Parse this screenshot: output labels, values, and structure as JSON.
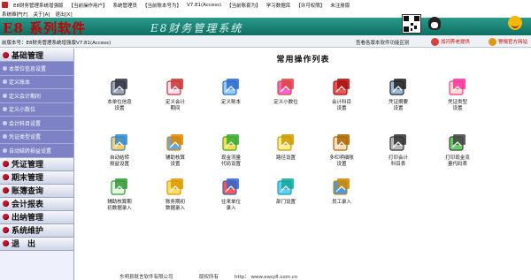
{
  "window": {
    "title": "E8财务管理系统增强版",
    "title_tabs": [
      "【当前操作用户】",
      "系统管理员",
      "【当前账本号为】",
      "V7.81(Access)",
      "【当前账套为】",
      "学习数据库",
      "【许可权限】",
      "未注册版"
    ]
  },
  "menu": [
    "系统维护[F]",
    "关于[A]",
    "退出[X]"
  ],
  "header": {
    "brand": "E8 系列软件",
    "banner": "E8财务管理系统"
  },
  "infobar": {
    "version": "前版本号：E8财务管理系统增强版V7.81(Access)",
    "compare": "查看各版本软件功能区别",
    "links": [
      "加河养老提供",
      "警惕官方网站"
    ]
  },
  "sidebar": {
    "groups": [
      {
        "label": "基础管理",
        "items": [
          "本单位信息设置",
          "定义账本",
          "定义会计期间",
          "定义小数位",
          "会计科目设置",
          "凭证类型设置",
          "自动结转损益设置"
        ]
      },
      {
        "label": "凭证管理"
      },
      {
        "label": "期末管理"
      },
      {
        "label": "账簿查询"
      },
      {
        "label": "会计报表"
      },
      {
        "label": "出纳管理"
      },
      {
        "label": "系统维护"
      },
      {
        "label": "退　出"
      }
    ]
  },
  "main": {
    "title": "常用操作列表",
    "tiles": [
      {
        "label": "本单位信息\n设置",
        "icon": "monitor-icon"
      },
      {
        "label": "定义会计\n期间",
        "icon": "calendar-icon"
      },
      {
        "label": "定义账本",
        "icon": "tools-icon"
      },
      {
        "label": "定义小数位",
        "icon": "books-icon"
      },
      {
        "label": "会计科目\n设置",
        "icon": "ledger-stack-icon"
      },
      {
        "label": "凭证摘要\n设置",
        "icon": "notebook-icon"
      },
      {
        "label": "凭证类型\n设置",
        "icon": "pen-book-icon"
      },
      {
        "label": "自动结转\n损益设置",
        "icon": "chart-book-icon"
      },
      {
        "label": "辅助核算\n设置",
        "icon": "pencil-ruler-icon"
      },
      {
        "label": "现金流量\n代码设置",
        "icon": "cash-flow-icon"
      },
      {
        "label": "路径设置",
        "icon": "hexagon-icon"
      },
      {
        "label": "多栏明细账\n设置",
        "icon": "writing-icon"
      },
      {
        "label": "打印会计\n科目表",
        "icon": "printer-icon"
      },
      {
        "label": "打印现金流\n量代码表",
        "icon": "print-list-icon"
      },
      {
        "label": "辅助核算期\n初数据录入",
        "icon": "checklist-icon"
      },
      {
        "label": "账务期初\n数据录入",
        "icon": "folders-icon"
      },
      {
        "label": "往来单位\n录入",
        "icon": "cursor-arrow-icon"
      },
      {
        "label": "部门设置",
        "icon": "org-cubes-icon"
      },
      {
        "label": "员工录入",
        "icon": "people-icon"
      }
    ]
  },
  "footer": {
    "company": "东明县既言软件有限公司",
    "contact": "版权所有",
    "website": "http： www.easy8.com.cn"
  },
  "colors": {
    "header": "#117164",
    "brand": "#c20000",
    "sidebar_sub": "#7d82c6",
    "group_dot": "#c8102e"
  }
}
